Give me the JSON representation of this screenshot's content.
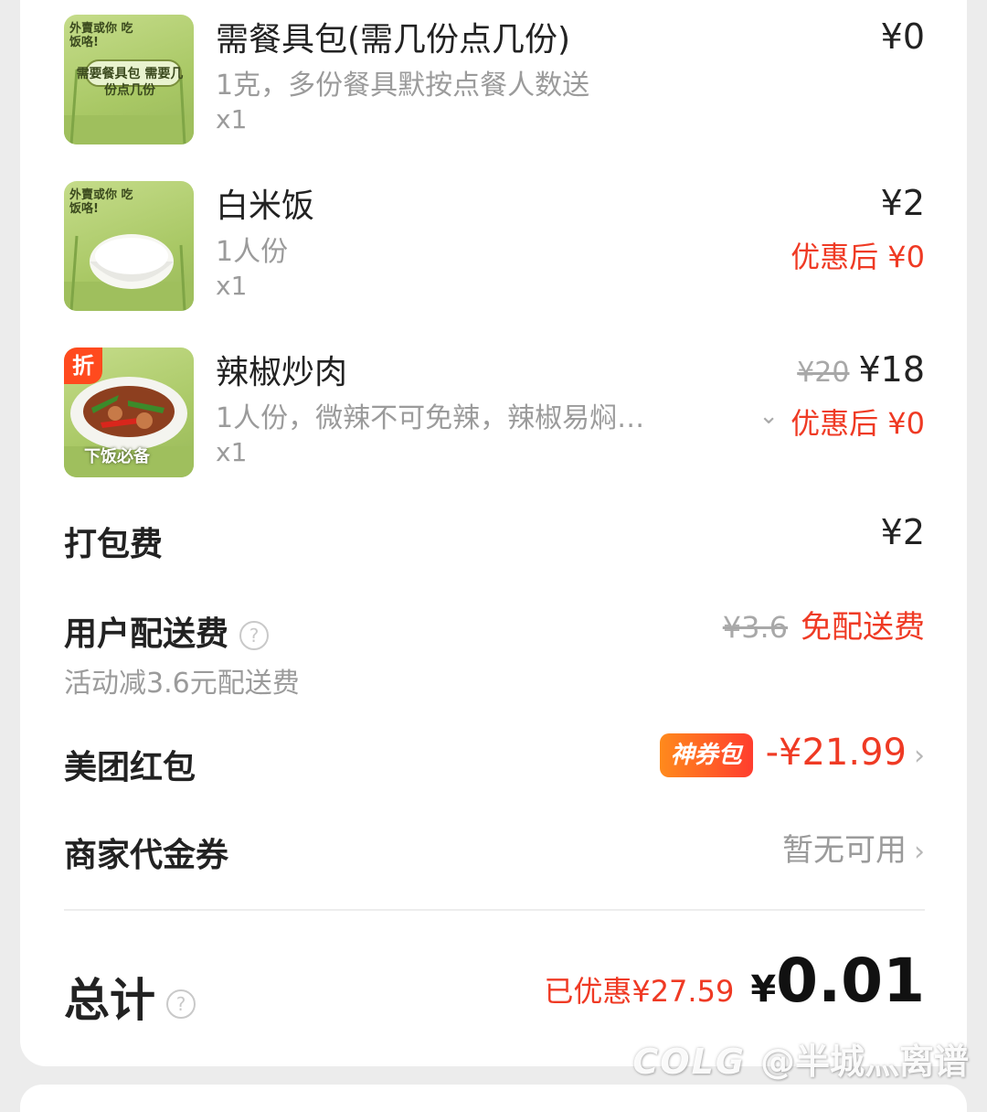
{
  "items": [
    {
      "thumb_caption_top": "外賣或你 吃饭咯!",
      "thumb_caption_main": "需要餐具包 需要几份点几份",
      "name": "需餐具包(需几份点几份)",
      "spec": "1克，多份餐具默按点餐人数送",
      "qty": "x1",
      "price": "¥0"
    },
    {
      "thumb_caption_top": "外賣或你 吃饭咯!",
      "name": "白米饭",
      "spec": "1人份",
      "qty": "x1",
      "price": "¥2",
      "discount_price": "优惠后 ¥0"
    },
    {
      "badge": "折",
      "thumb_caption_bottom": "下饭必备",
      "name": "辣椒炒肉",
      "spec": "1人份，微辣不可免辣，辣椒易焖…",
      "qty": "x1",
      "original_price": "¥20",
      "price": "¥18",
      "discount_price": "优惠后 ¥0"
    }
  ],
  "packing_fee": {
    "label": "打包费",
    "value": "¥2"
  },
  "delivery_fee": {
    "label": "用户配送费",
    "note": "活动减3.6元配送费",
    "original": "¥3.6",
    "value": "免配送费"
  },
  "red_packet": {
    "label": "美团红包",
    "badge": "神券包",
    "value": "-¥21.99"
  },
  "merchant_voucher": {
    "label": "商家代金券",
    "value": "暂无可用"
  },
  "total": {
    "label": "总计",
    "saved": "已优惠¥27.59",
    "currency": "¥",
    "amount": "0.01"
  },
  "watermark": {
    "logo": "COLG",
    "handle": "@半城灬离谱"
  },
  "colors": {
    "accent_red": "#ef3a24",
    "badge_orange": "#ff8a1c",
    "muted": "#9b9b9b"
  },
  "icons": [
    "help-circle-icon",
    "chevron-right-icon",
    "chevron-down-icon"
  ]
}
